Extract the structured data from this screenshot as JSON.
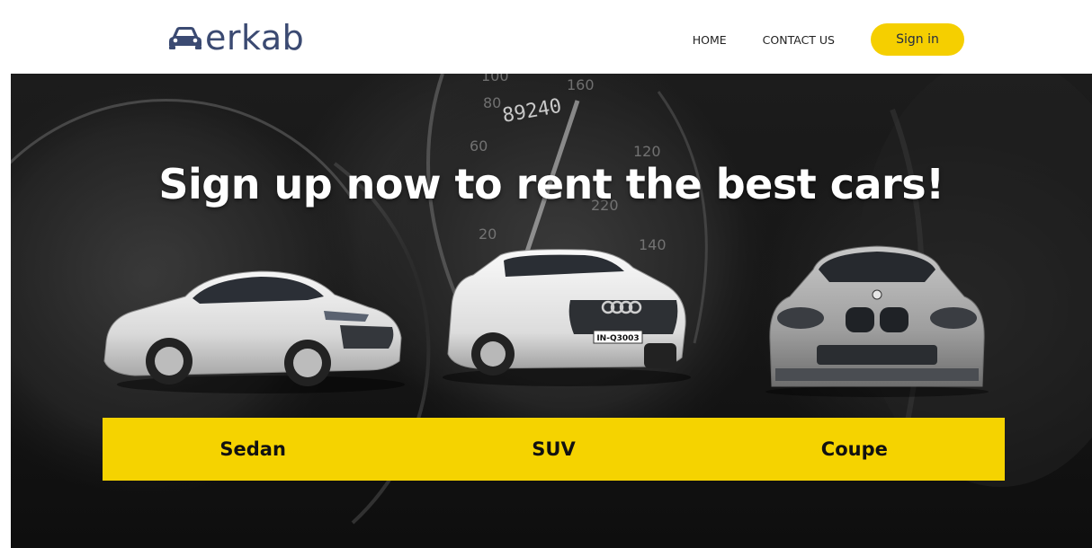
{
  "header": {
    "logo_text": "erkab",
    "nav": {
      "home": "HOME",
      "contact": "CONTACT US",
      "signin": "Sign in"
    }
  },
  "hero": {
    "title": "Sign up now to rent the best cars!",
    "speedometer": {
      "odometer": "89240",
      "ticks": [
        "100",
        "80",
        "60",
        "20",
        "120",
        "140",
        "160",
        "220"
      ]
    },
    "cars": [
      {
        "type": "sedan",
        "plate": ""
      },
      {
        "type": "suv",
        "plate": "IN-Q3003"
      },
      {
        "type": "coupe",
        "plate": ""
      }
    ],
    "categories": [
      "Sedan",
      "SUV",
      "Coupe"
    ]
  },
  "colors": {
    "accent": "#f5d300",
    "logo": "#3b4a72",
    "title": "#ffffff"
  }
}
